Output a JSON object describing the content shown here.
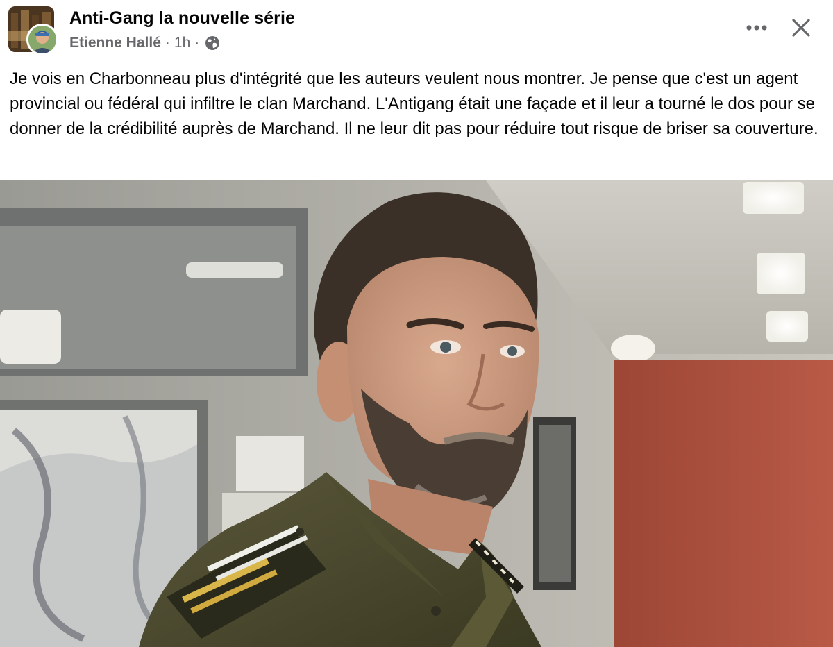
{
  "header": {
    "group_name": "Anti-Gang la nouvelle série",
    "author": "Etienne Hallé",
    "time": "1h",
    "separator": "·",
    "visibility_icon": "globe-icon"
  },
  "actions": {
    "more_icon": "more-horizontal-icon",
    "close_icon": "close-icon"
  },
  "post": {
    "text": "Je vois en Charbonneau plus d'intégrité que les auteurs veulent nous montrer. Je pense que c'est un agent provincial ou fédéral qui infiltre le clan Marchand. L'Antigang était une façade et il leur a tourné le dos pour se donner de la crédibilité auprès de Marchand. Il ne leur dit pas pour réduire tout risque de briser sa couverture."
  },
  "colors": {
    "text_primary": "#050505",
    "text_secondary": "#65676b",
    "background": "#ffffff",
    "uniform": "#4b4a2c",
    "wall_red": "#a44c3a"
  }
}
